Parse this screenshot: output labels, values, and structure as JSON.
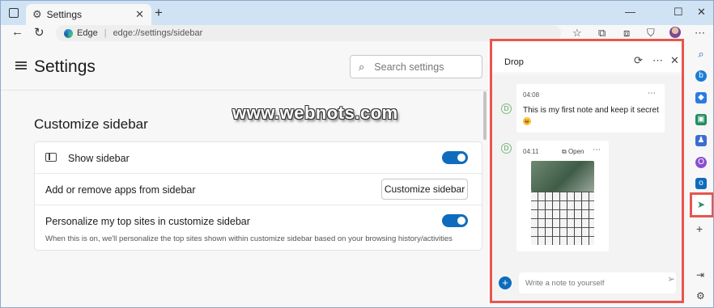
{
  "tab": {
    "title": "Settings",
    "close": "✕",
    "new_tab": "+"
  },
  "window_controls": {
    "minimize": "—",
    "maximize": "☐",
    "close": "✕"
  },
  "address_bar": {
    "site_label": "Edge",
    "url": "edge://settings/sidebar"
  },
  "settings": {
    "title": "Settings",
    "search_placeholder": "Search settings",
    "section_title": "Customize sidebar",
    "rows": [
      {
        "label": "Show sidebar",
        "toggle_on": true
      },
      {
        "label": "Add or remove apps from sidebar",
        "button": "Customize sidebar"
      },
      {
        "label": "Personalize my top sites in customize sidebar",
        "toggle_on": true,
        "description": "When this is on, we'll personalize the top sites shown within customize sidebar based on your browsing history/activities"
      }
    ]
  },
  "watermark": "www.webnots.com",
  "drop_panel": {
    "title": "Drop",
    "notes": [
      {
        "time": "04:08",
        "text": "This is my first note and keep it secret",
        "emoji": "😛"
      },
      {
        "time": "04:11",
        "open_label": "Open",
        "has_image": true
      }
    ],
    "input_placeholder": "Write a note to yourself"
  },
  "sidebar_apps": [
    "search-icon",
    "bing-icon",
    "shopping-icon",
    "tools-icon",
    "games-icon",
    "office-icon",
    "outlook-icon",
    "drop-icon"
  ],
  "colors": {
    "accent": "#0f6cbd",
    "highlight": "#e8564e"
  }
}
